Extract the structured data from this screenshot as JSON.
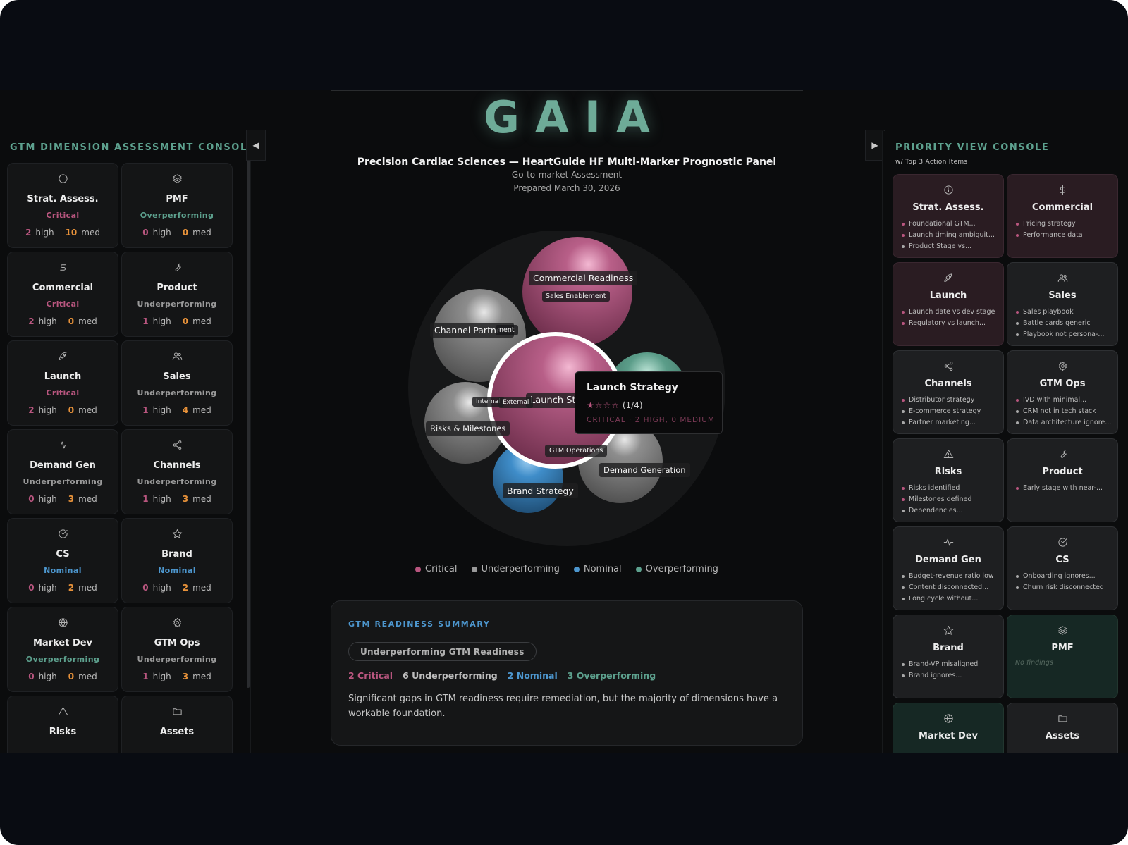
{
  "colors": {
    "critical": "#b9567f",
    "underperforming": "#9a9a9a",
    "nominal": "#4d97cf",
    "overperforming": "#5da18e",
    "med": "#e8923a",
    "brand": "#6eab98"
  },
  "left_panel": {
    "title": "GTM DIMENSION ASSESSMENT CONSOLE",
    "high_label": "high",
    "med_label": "med",
    "cards": [
      {
        "name": "Strat. Assess.",
        "icon": "info-icon",
        "status": "Critical",
        "status_key": "critical",
        "high": "2",
        "med": "10"
      },
      {
        "name": "PMF",
        "icon": "layers-icon",
        "status": "Overperforming",
        "status_key": "overperforming",
        "high": "0",
        "med": "0"
      },
      {
        "name": "Commercial",
        "icon": "dollar-icon",
        "status": "Critical",
        "status_key": "critical",
        "high": "2",
        "med": "0"
      },
      {
        "name": "Product",
        "icon": "wrench-icon",
        "status": "Underperforming",
        "status_key": "underperforming",
        "high": "1",
        "med": "0"
      },
      {
        "name": "Launch",
        "icon": "rocket-icon",
        "status": "Critical",
        "status_key": "critical",
        "high": "2",
        "med": "0"
      },
      {
        "name": "Sales",
        "icon": "users-icon",
        "status": "Underperforming",
        "status_key": "underperforming",
        "high": "1",
        "med": "4"
      },
      {
        "name": "Demand Gen",
        "icon": "pulse-icon",
        "status": "Underperforming",
        "status_key": "underperforming",
        "high": "0",
        "med": "3"
      },
      {
        "name": "Channels",
        "icon": "share-icon",
        "status": "Underperforming",
        "status_key": "underperforming",
        "high": "1",
        "med": "3"
      },
      {
        "name": "CS",
        "icon": "check-circle-icon",
        "status": "Nominal",
        "status_key": "nominal",
        "high": "0",
        "med": "2"
      },
      {
        "name": "Brand",
        "icon": "star-icon",
        "status": "Nominal",
        "status_key": "nominal",
        "high": "0",
        "med": "2"
      },
      {
        "name": "Market Dev",
        "icon": "globe-icon",
        "status": "Overperforming",
        "status_key": "overperforming",
        "high": "0",
        "med": "0"
      },
      {
        "name": "GTM Ops",
        "icon": "gear-icon",
        "status": "Underperforming",
        "status_key": "underperforming",
        "high": "1",
        "med": "3"
      },
      {
        "name": "Risks",
        "icon": "warning-icon",
        "status": "",
        "status_key": "",
        "high": "",
        "med": ""
      },
      {
        "name": "Assets",
        "icon": "folder-icon",
        "status": "",
        "status_key": "",
        "high": "",
        "med": ""
      }
    ]
  },
  "header": {
    "logo": "GAIA",
    "company_title": "Precision Cardiac Sciences — HeartGuide HF Multi-Marker Prognostic Panel",
    "assessment": "Go-to-market Assessment",
    "prepared": "Prepared March 30, 2026"
  },
  "bubbles": [
    {
      "label": "Commercial Readiness",
      "sub": "Sales Enablement"
    },
    {
      "label": "Channel Partners",
      "sub": "nent"
    },
    {
      "label": "Risks & Milestones",
      "sub": ""
    },
    {
      "label": "Launch St",
      "sub": "Internal"
    },
    {
      "label": "External",
      "sub": ""
    },
    {
      "label": "GTM Operations",
      "sub": ""
    },
    {
      "label": "Demand Generation",
      "sub": ""
    },
    {
      "label": "Brand Strategy",
      "sub": ""
    }
  ],
  "tooltip": {
    "title": "Launch Strategy",
    "stars": "★☆☆☆",
    "score": "(1/4)",
    "detail": "CRITICAL · 2 HIGH, 0 MEDIUM"
  },
  "legend": [
    {
      "label": "Critical",
      "key": "critical"
    },
    {
      "label": "Underperforming",
      "key": "underperforming"
    },
    {
      "label": "Nominal",
      "key": "nominal"
    },
    {
      "label": "Overperforming",
      "key": "overperforming"
    }
  ],
  "summary": {
    "heading": "GTM READINESS SUMMARY",
    "pill": "Underperforming GTM Readiness",
    "counts": [
      {
        "text": "2 Critical",
        "key": "critical"
      },
      {
        "text": "6 Underperforming",
        "key": "underperforming"
      },
      {
        "text": "2 Nominal",
        "key": "nominal"
      },
      {
        "text": "3 Overperforming",
        "key": "overperforming"
      }
    ],
    "description": "Significant gaps in GTM readiness require remediation, but the majority of dimensions have a workable foundation."
  },
  "right_panel": {
    "title": "PRIORITY VIEW CONSOLE",
    "subtitle": "w/ Top 3 Action Items",
    "no_findings": "No findings",
    "cards": [
      {
        "name": "Strat. Assess.",
        "icon": "info-icon",
        "tone": "crit",
        "items": [
          {
            "t": "Foundational GTM...",
            "k": "critical"
          },
          {
            "t": "Launch timing ambiguit...",
            "k": "critical"
          },
          {
            "t": "Product Stage vs...",
            "k": "underperforming"
          }
        ]
      },
      {
        "name": "Commercial",
        "icon": "dollar-icon",
        "tone": "crit",
        "items": [
          {
            "t": "Pricing strategy",
            "k": "critical"
          },
          {
            "t": "Performance data",
            "k": "critical"
          }
        ]
      },
      {
        "name": "Launch",
        "icon": "rocket-icon",
        "tone": "crit",
        "items": [
          {
            "t": "Launch date vs dev stage",
            "k": "critical"
          },
          {
            "t": "Regulatory vs launch...",
            "k": "critical"
          }
        ]
      },
      {
        "name": "Sales",
        "icon": "users-icon",
        "tone": "under",
        "items": [
          {
            "t": "Sales playbook",
            "k": "critical"
          },
          {
            "t": "Battle cards generic",
            "k": "underperforming"
          },
          {
            "t": "Playbook not persona-...",
            "k": "underperforming"
          }
        ]
      },
      {
        "name": "Channels",
        "icon": "share-icon",
        "tone": "under",
        "items": [
          {
            "t": "Distributor strategy",
            "k": "critical"
          },
          {
            "t": "E-commerce strategy",
            "k": "underperforming"
          },
          {
            "t": "Partner marketing...",
            "k": "underperforming"
          }
        ]
      },
      {
        "name": "GTM Ops",
        "icon": "gear-icon",
        "tone": "under",
        "items": [
          {
            "t": "IVD with minimal...",
            "k": "critical"
          },
          {
            "t": "CRM not in tech stack",
            "k": "underperforming"
          },
          {
            "t": "Data architecture ignore...",
            "k": "underperforming"
          }
        ]
      },
      {
        "name": "Risks",
        "icon": "warning-icon",
        "tone": "under",
        "items": [
          {
            "t": "Risks identified",
            "k": "critical"
          },
          {
            "t": "Milestones defined",
            "k": "critical"
          },
          {
            "t": "Dependencies...",
            "k": "underperforming"
          }
        ]
      },
      {
        "name": "Product",
        "icon": "wrench-icon",
        "tone": "under",
        "items": [
          {
            "t": "Early stage with near-...",
            "k": "critical"
          }
        ]
      },
      {
        "name": "Demand Gen",
        "icon": "pulse-icon",
        "tone": "under",
        "items": [
          {
            "t": "Budget-revenue ratio low",
            "k": "underperforming"
          },
          {
            "t": "Content disconnected...",
            "k": "underperforming"
          },
          {
            "t": "Long cycle without...",
            "k": "underperforming"
          }
        ]
      },
      {
        "name": "CS",
        "icon": "check-circle-icon",
        "tone": "under",
        "items": [
          {
            "t": "Onboarding ignores...",
            "k": "underperforming"
          },
          {
            "t": "Churn risk disconnected",
            "k": "underperforming"
          }
        ]
      },
      {
        "name": "Brand",
        "icon": "star-icon",
        "tone": "under",
        "items": [
          {
            "t": "Brand-VP misaligned",
            "k": "underperforming"
          },
          {
            "t": "Brand ignores...",
            "k": "underperforming"
          }
        ]
      },
      {
        "name": "PMF",
        "icon": "layers-icon",
        "tone": "over",
        "items": []
      },
      {
        "name": "Market Dev",
        "icon": "globe-icon",
        "tone": "over",
        "items": []
      },
      {
        "name": "Assets",
        "icon": "folder-icon",
        "tone": "under",
        "items": []
      }
    ]
  }
}
